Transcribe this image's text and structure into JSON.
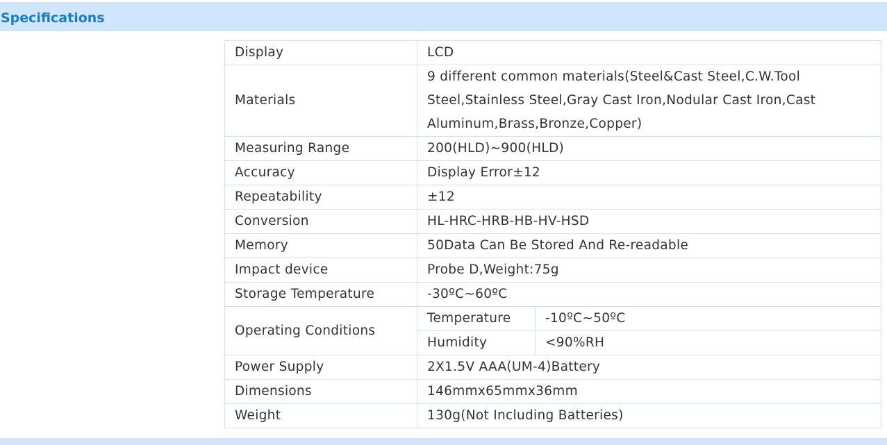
{
  "header": {
    "title": "Specifications"
  },
  "specs": {
    "display": {
      "label": "Display",
      "value": "LCD"
    },
    "materials": {
      "label": "Materials",
      "value": "9 different common materials(Steel&Cast Steel,C.W.Tool Steel,Stainless Steel,Gray Cast Iron,Nodular Cast Iron,Cast Aluminum,Brass,Bronze,Copper)"
    },
    "measuring_range": {
      "label": "Measuring Range",
      "value": "200(HLD)~900(HLD)"
    },
    "accuracy": {
      "label": "Accuracy",
      "value": "Display Error±12"
    },
    "repeatability": {
      "label": "Repeatability",
      "value": "±12"
    },
    "conversion": {
      "label": "Conversion",
      "value": "HL-HRC-HRB-HB-HV-HSD"
    },
    "memory": {
      "label": "Memory",
      "value": "50Data Can Be Stored And Re-readable"
    },
    "impact_device": {
      "label": "Impact device",
      "value": "Probe D,Weight:75g"
    },
    "storage_temperature": {
      "label": "Storage Temperature",
      "value": "-30ºC~60ºC"
    },
    "operating_conditions": {
      "label": "Operating Conditions",
      "temperature": {
        "label": "Temperature",
        "value": "-10ºC~50ºC"
      },
      "humidity": {
        "label": "Humidity",
        "value": "<90%RH"
      }
    },
    "power_supply": {
      "label": "Power Supply",
      "value": "2X1.5V AAA(UM-4)Battery"
    },
    "dimensions": {
      "label": "Dimensions",
      "value": "146mmx65mmx36mm"
    },
    "weight": {
      "label": "Weight",
      "value": "130g(Not Including Batteries)"
    }
  },
  "colors": {
    "header_bg": "#cfe6fb",
    "header_text": "#1a7fc0",
    "border": "#c9e3f4",
    "text": "#333333"
  }
}
